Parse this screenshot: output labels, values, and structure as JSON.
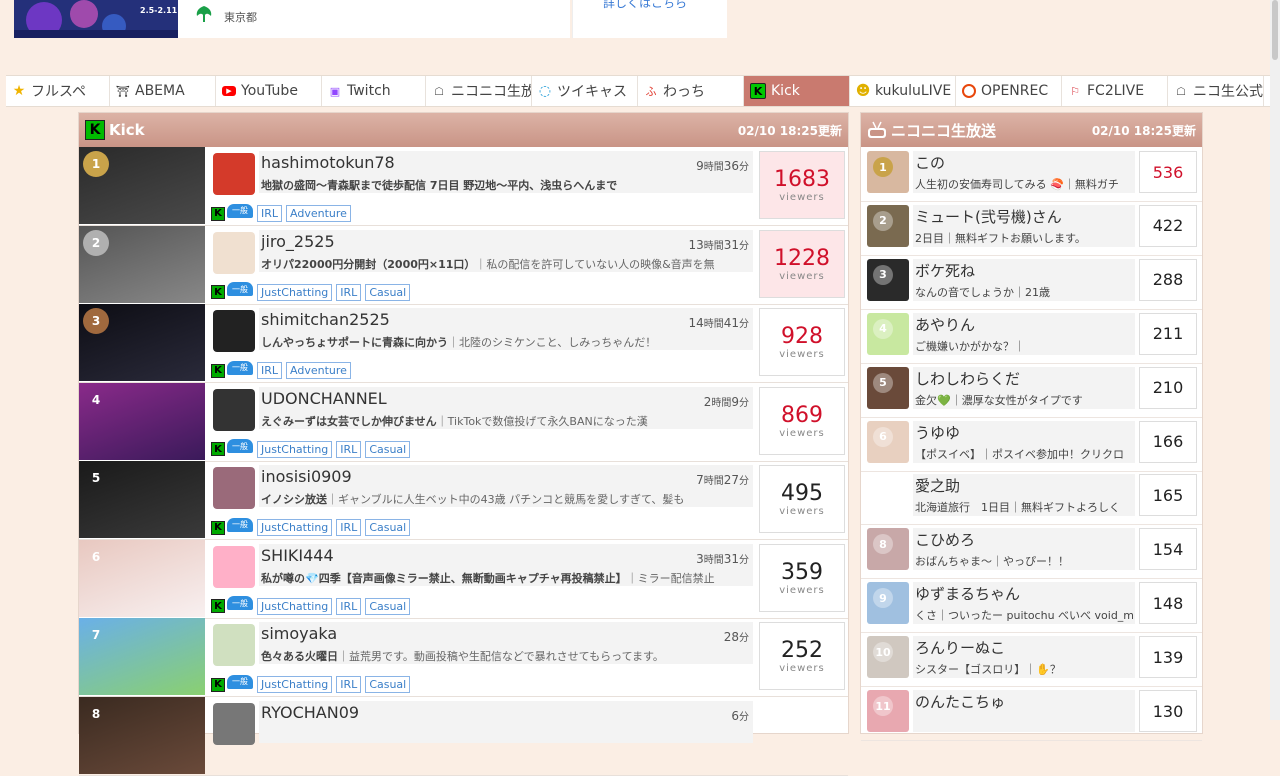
{
  "banner": {
    "dates": "2.5-2.11"
  },
  "tokyo": {
    "label": "東京都"
  },
  "detail": {
    "label": "詳しくはこちら"
  },
  "tabs": [
    {
      "label": "フルスペ",
      "icon": "star-icon",
      "color": "#f0b400",
      "w": 104
    },
    {
      "label": "ABEMA",
      "icon": "abema-icon",
      "color": "#222222",
      "w": 106
    },
    {
      "label": "YouTube",
      "icon": "youtube-icon",
      "color": "#ff0000",
      "w": 106
    },
    {
      "label": "Twitch",
      "icon": "twitch-icon",
      "color": "#9146ff",
      "w": 104
    },
    {
      "label": "ニコニコ生放送",
      "icon": "niconico-icon",
      "color": "#555555",
      "w": 106
    },
    {
      "label": "ツイキャス",
      "icon": "twitcasting-icon",
      "color": "#1e9bd7",
      "w": 106
    },
    {
      "label": "わっち",
      "icon": "wacchi-icon",
      "color": "#e03a2e",
      "w": 106
    },
    {
      "label": "Kick",
      "icon": "kick-icon",
      "color": "#00c800",
      "w": 106,
      "active": true
    },
    {
      "label": "kukuluLIVE",
      "icon": "kukulu-icon",
      "color": "#e0b000",
      "w": 106
    },
    {
      "label": "OPENREC",
      "icon": "openrec-icon",
      "color": "#e8470c",
      "w": 106
    },
    {
      "label": "FC2LIVE",
      "icon": "fc2-icon",
      "color": "#d8313b",
      "w": 106
    },
    {
      "label": "ニコ生公式",
      "icon": "nico-official-icon",
      "color": "#555555",
      "w": 96
    }
  ],
  "kick": {
    "title": "Kick",
    "updated": "02/10 18:25更新",
    "viewers_label": "viewers",
    "rows": [
      {
        "rank": "1",
        "name": "hashimotokun78",
        "dur_h": "9",
        "dur_m": "36",
        "desc_main": "地獄の盛岡～青森駅まで徒歩配信 7日目 野辺地～平内、浅虫らへんまで",
        "desc_sub": "",
        "tags": [
          "IRL",
          "Adventure"
        ],
        "viewers": "1683",
        "hot": true
      },
      {
        "rank": "2",
        "name": "jiro_2525",
        "dur_h": "13",
        "dur_m": "31",
        "desc_main": "オリパ22000円分開封（2000円×11口）",
        "desc_sub": "｜私の配信を許可していない人の映像&音声を無",
        "tags": [
          "JustChatting",
          "IRL",
          "Casual"
        ],
        "viewers": "1228",
        "hot": true
      },
      {
        "rank": "3",
        "name": "shimitchan2525",
        "dur_h": "14",
        "dur_m": "41",
        "desc_main": "しんやっちょサポートに青森に向かう",
        "desc_sub": "｜北陸のシミケンこと、しみっちゃんだ！",
        "tags": [
          "IRL",
          "Adventure"
        ],
        "viewers": "928",
        "hot": false
      },
      {
        "rank": "4",
        "name": "UDONCHANNEL",
        "dur_h": "2",
        "dur_m": "9",
        "desc_main": "えぐみーずは女芸でしか伸びません",
        "desc_sub": "｜TikTokで数億投げて永久BANになった漢",
        "tags": [
          "JustChatting",
          "IRL",
          "Casual"
        ],
        "viewers": "869",
        "hot": false
      },
      {
        "rank": "5",
        "name": "inosisi0909",
        "dur_h": "7",
        "dur_m": "27",
        "desc_main": "イノシシ放送",
        "desc_sub": "｜ギャンブルに人生ベット中の43歳 パチンコと競馬を愛しすぎて、髪も",
        "tags": [
          "JustChatting",
          "IRL",
          "Casual"
        ],
        "viewers": "495",
        "hot": false
      },
      {
        "rank": "6",
        "name": "SHIKI444",
        "dur_h": "3",
        "dur_m": "31",
        "desc_main": "私が噂の💎四季【音声画像ミラー禁止、無断動画キャプチャ再投稿禁止】",
        "desc_sub": "｜ミラー配信禁止",
        "tags": [
          "JustChatting",
          "IRL",
          "Casual"
        ],
        "viewers": "359",
        "hot": false
      },
      {
        "rank": "7",
        "name": "simoyaka",
        "dur_h": "",
        "dur_m": "28",
        "desc_main": "色々ある火曜日",
        "desc_sub": "｜益荒男です。動画投稿や生配信などで暴れさせてもらってます。",
        "tags": [
          "JustChatting",
          "IRL",
          "Casual"
        ],
        "viewers": "252",
        "hot": false
      },
      {
        "rank": "8",
        "name": "RYOCHAN09",
        "dur_h": "",
        "dur_m": "6",
        "desc_main": "",
        "desc_sub": "",
        "tags": [],
        "viewers": "",
        "hot": false
      }
    ]
  },
  "nico": {
    "title": "ニコニコ生放送",
    "updated": "02/10 18:25更新",
    "rows": [
      {
        "rank": "1",
        "name": "この",
        "desc": "人生初の安価寿司してみる 🍣｜無料ガチ",
        "viewers": "536",
        "red": true
      },
      {
        "rank": "2",
        "name": "ミュート(弐号機)さん",
        "desc": "2日目｜無料ギフトお願いします。",
        "viewers": "422",
        "red": false
      },
      {
        "rank": "3",
        "name": "ボケ死ね",
        "desc": "なんの音でしょうか｜21歳",
        "viewers": "288",
        "red": false
      },
      {
        "rank": "4",
        "name": "あやりん",
        "desc": "ご機嫌いかがかな？｜",
        "viewers": "211",
        "red": false
      },
      {
        "rank": "5",
        "name": "しわしわらくだ",
        "desc": "金欠💚｜濃厚な女性がタイプです",
        "viewers": "210",
        "red": false
      },
      {
        "rank": "6",
        "name": "うゆゆ",
        "desc": "【ポスイベ】｜ポスイベ参加中！クリクロ",
        "viewers": "166",
        "red": false
      },
      {
        "rank": "7",
        "name": "愛之助",
        "desc": "北海道旅行　1日目｜無料ギフトよろしく",
        "viewers": "165",
        "red": false
      },
      {
        "rank": "8",
        "name": "こひめろ",
        "desc": "おばんちゃま～｜やっぴー！！",
        "viewers": "154",
        "red": false
      },
      {
        "rank": "9",
        "name": "ゆずまるちゃん",
        "desc": "くさ｜ついったー puitochu べいべ void_m",
        "viewers": "148",
        "red": false
      },
      {
        "rank": "10",
        "name": "ろんりーぬこ",
        "desc": "シスター【ゴスロリ】｜✋？",
        "viewers": "139",
        "red": false
      },
      {
        "rank": "11",
        "name": "のんたこちゅ",
        "desc": "",
        "viewers": "130",
        "red": false
      }
    ]
  }
}
